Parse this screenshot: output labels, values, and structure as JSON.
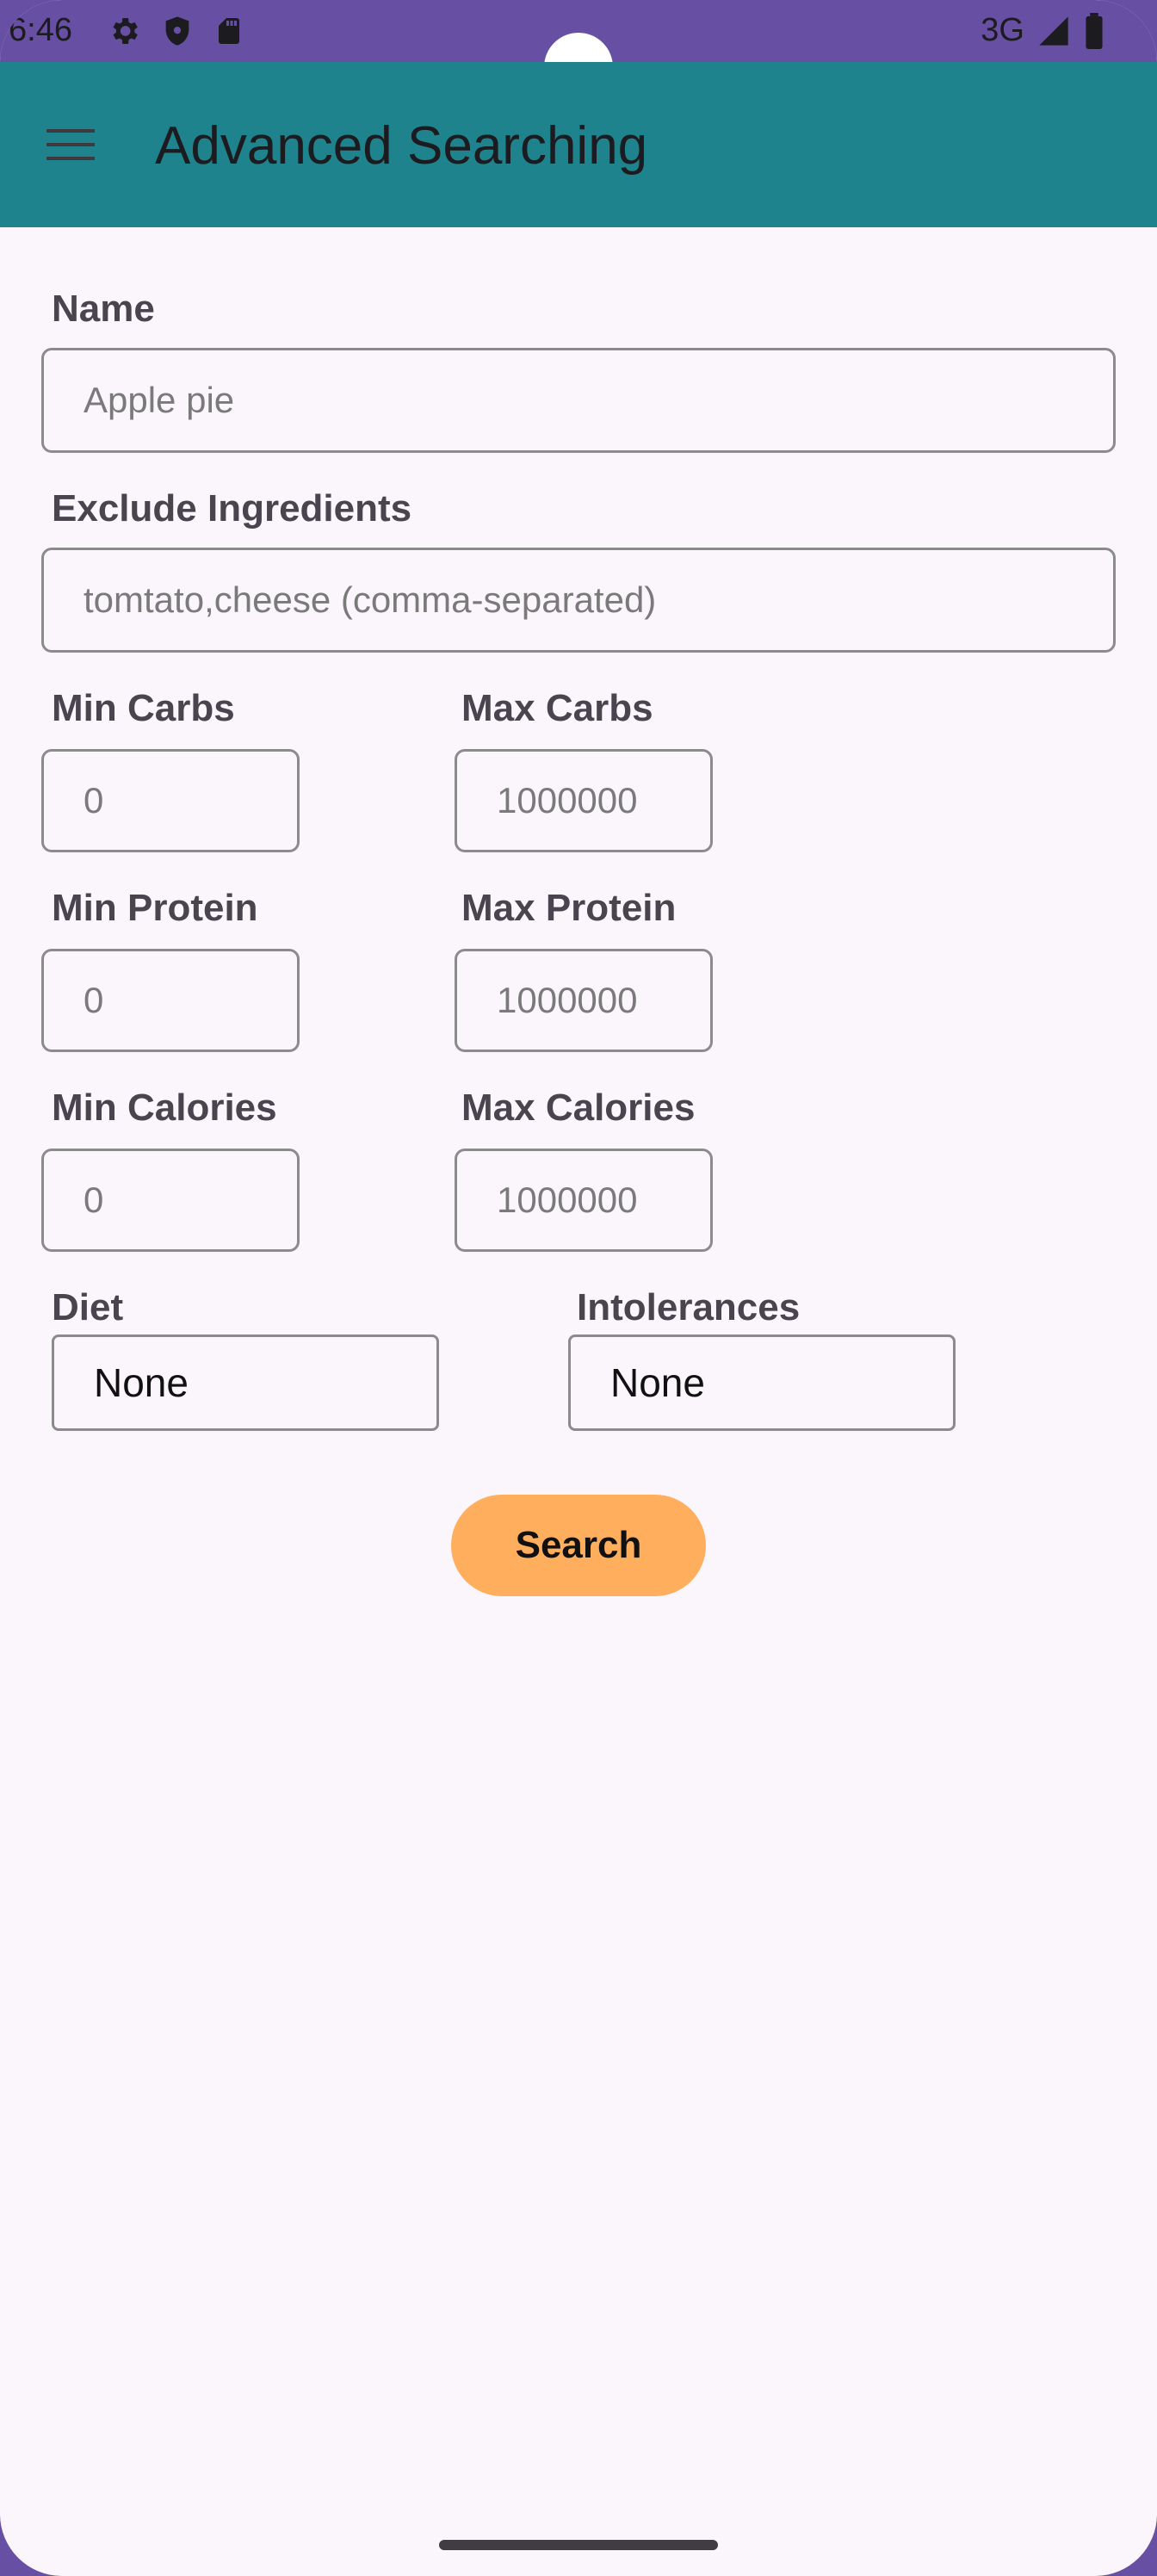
{
  "status_bar": {
    "time": "6:46",
    "network": "3G",
    "icons_left": [
      "settings-icon",
      "shield-icon",
      "sd-card-icon"
    ],
    "icons_right": [
      "signal-icon",
      "battery-icon"
    ]
  },
  "app_bar": {
    "title": "Advanced Searching",
    "menu_icon": "hamburger-menu-icon",
    "color": "#1f838d"
  },
  "form": {
    "name": {
      "label": "Name",
      "placeholder": "Apple pie"
    },
    "exclude": {
      "label": "Exclude Ingredients",
      "placeholder": "tomtato,cheese (comma-separated)"
    },
    "min_carbs": {
      "label": "Min Carbs",
      "placeholder": "0"
    },
    "max_carbs": {
      "label": "Max Carbs",
      "placeholder": "1000000"
    },
    "min_protein": {
      "label": "Min Protein",
      "placeholder": "0"
    },
    "max_protein": {
      "label": "Max Protein",
      "placeholder": "1000000"
    },
    "min_calories": {
      "label": "Min Calories",
      "placeholder": "0"
    },
    "max_calories": {
      "label": "Max Calories",
      "placeholder": "1000000"
    },
    "diet": {
      "label": "Diet",
      "value": "None"
    },
    "intolerances": {
      "label": "Intolerances",
      "value": "None"
    },
    "search_label": "Search",
    "search_color": "#ffae5e"
  }
}
